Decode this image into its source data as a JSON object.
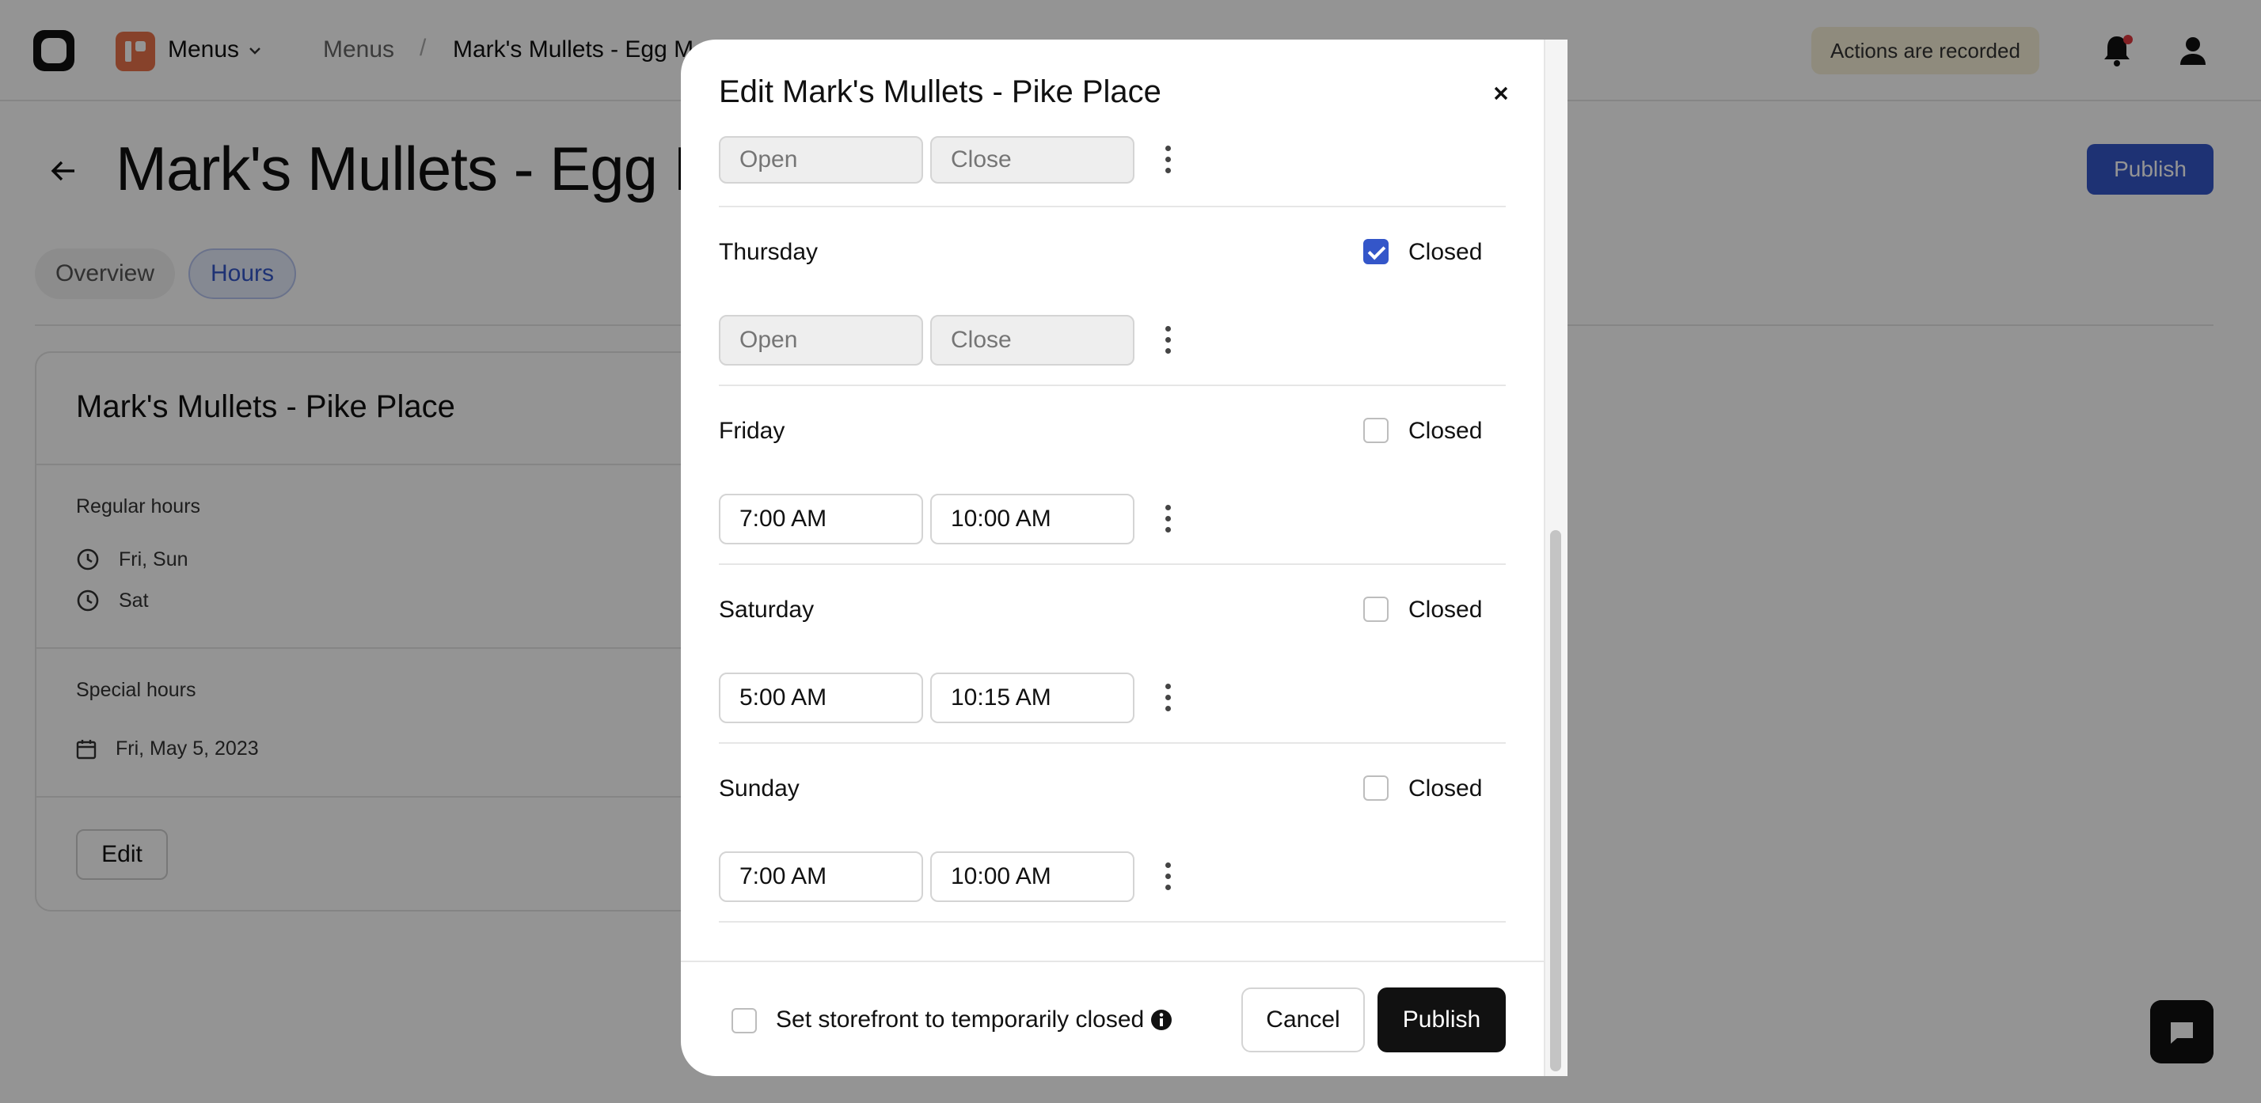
{
  "topbar": {
    "app_name": "Menus",
    "breadcrumbs": [
      "Menus",
      "Mark's Mullets - Egg Me"
    ],
    "crumb_separator": "/",
    "recorded_badge": "Actions are recorded"
  },
  "page": {
    "title": "Mark's Mullets - Egg Me",
    "publish_label": "Publish",
    "tabs": [
      {
        "label": "Overview",
        "active": false
      },
      {
        "label": "Hours",
        "active": true
      }
    ]
  },
  "card": {
    "title": "Mark's Mullets - Pike Place",
    "regular_hours_label": "Regular hours",
    "regular_hours": [
      "Fri, Sun",
      "Sat"
    ],
    "special_hours_label": "Special hours",
    "special_hours": [
      "Fri, May 5, 2023"
    ],
    "edit_label": "Edit"
  },
  "modal": {
    "title": "Edit Mark's Mullets - Pike Place",
    "open_placeholder": "Open",
    "close_placeholder": "Close",
    "closed_label": "Closed",
    "partial_row": {
      "open": "",
      "close": ""
    },
    "days": [
      {
        "name": "Thursday",
        "closed": true,
        "open": "",
        "close": ""
      },
      {
        "name": "Friday",
        "closed": false,
        "open": "7:00 AM",
        "close": "10:00 AM"
      },
      {
        "name": "Saturday",
        "closed": false,
        "open": "5:00 AM",
        "close": "10:15 AM"
      },
      {
        "name": "Sunday",
        "closed": false,
        "open": "7:00 AM",
        "close": "10:00 AM"
      }
    ],
    "footer": {
      "temp_closed_label": "Set storefront to temporarily closed",
      "cancel_label": "Cancel",
      "publish_label": "Publish"
    }
  },
  "colors": {
    "accent": "#3456c9",
    "badge_bg": "#f6efd8",
    "notification_dot": "#e0383e",
    "app_icon": "#e8734a"
  },
  "icons": [
    "logo-icon",
    "menus-app-icon",
    "chevron-down-icon",
    "bell-icon",
    "user-icon",
    "back-arrow-icon",
    "clock-icon",
    "calendar-icon",
    "close-icon",
    "kebab-icon",
    "info-icon",
    "chat-icon"
  ]
}
